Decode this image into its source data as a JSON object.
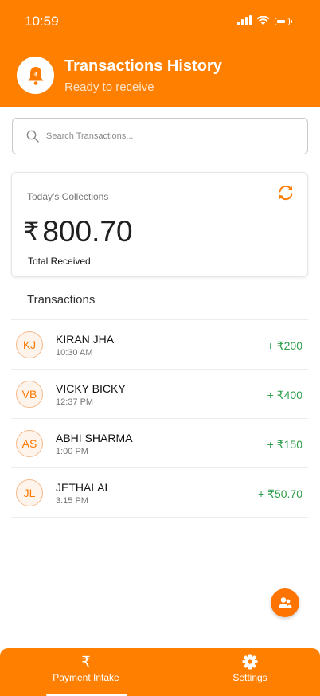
{
  "status_bar": {
    "time": "10:59"
  },
  "header": {
    "title": "Transactions History",
    "subtitle": "Ready to receive",
    "icon": "bell-rupee-icon"
  },
  "search": {
    "placeholder": "Search Transactions..."
  },
  "collections": {
    "label": "Today's Collections",
    "currency": "₹",
    "amount": "800.70",
    "footer": "Total Received"
  },
  "transactions": {
    "title": "Transactions",
    "items": [
      {
        "initials": "KJ",
        "name": "KIRAN JHA",
        "time": "10:30 AM",
        "amount": "+ ₹200"
      },
      {
        "initials": "VB",
        "name": "VICKY BICKY",
        "time": "12:37 PM",
        "amount": "+ ₹400"
      },
      {
        "initials": "AS",
        "name": "ABHI SHARMA",
        "time": "1:00 PM",
        "amount": "+ ₹150"
      },
      {
        "initials": "JL",
        "name": "JETHALAL",
        "time": "3:15 PM",
        "amount": "+ ₹50.70"
      }
    ]
  },
  "bottom_nav": {
    "payment": {
      "label": "Payment Intake",
      "icon": "₹"
    },
    "settings": {
      "label": "Settings",
      "icon": "gear-icon"
    }
  },
  "colors": {
    "primary": "#ff8000",
    "credit": "#2e9d4b"
  }
}
